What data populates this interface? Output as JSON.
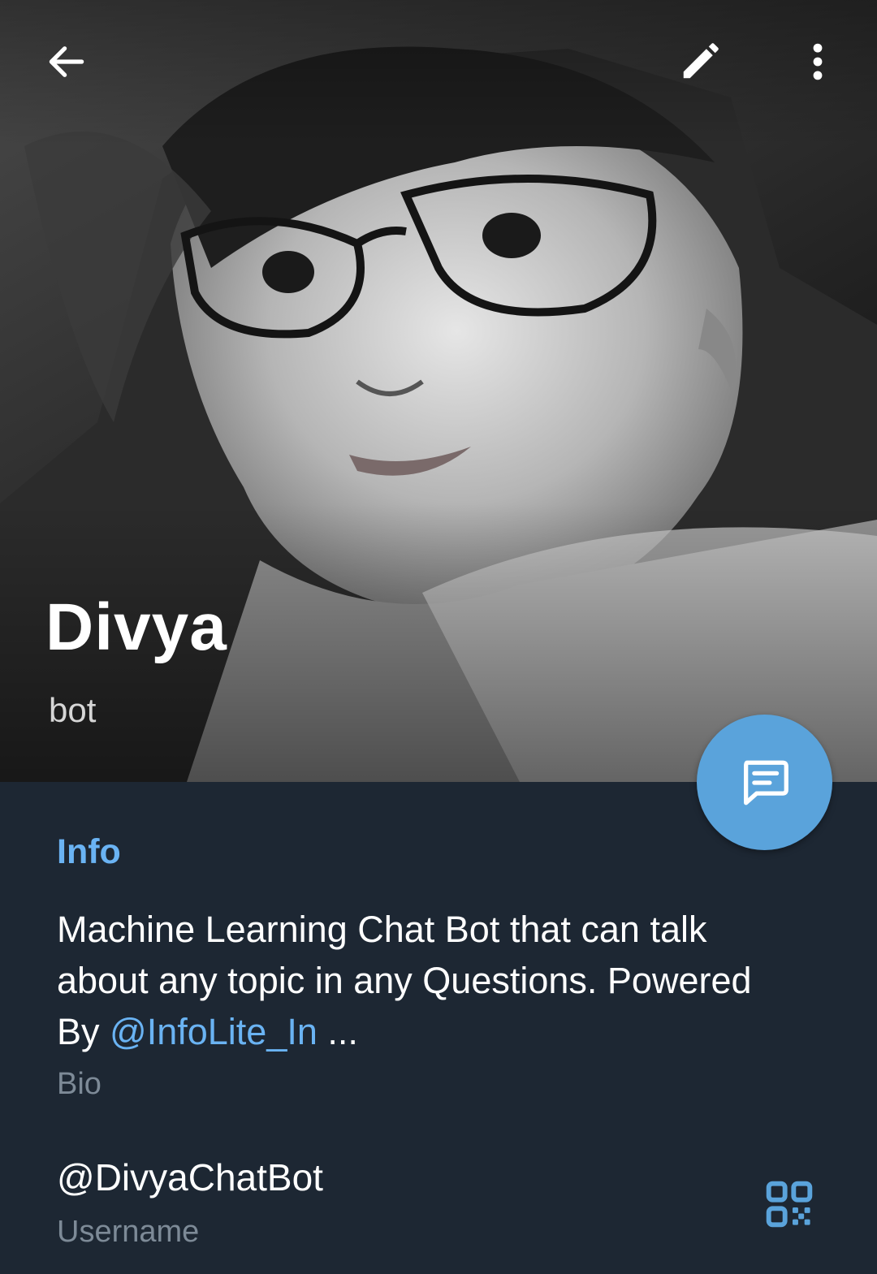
{
  "profile": {
    "name": "Divya",
    "status": "bot"
  },
  "toolbar": {
    "back_icon": "arrow-left-icon",
    "edit_icon": "pencil-icon",
    "more_icon": "more-vertical-icon"
  },
  "fab": {
    "icon": "message-icon"
  },
  "info": {
    "title": "Info",
    "bio_text": "Machine Learning Chat Bot that can talk about any topic in any Questions. Powered By ",
    "bio_link": "@InfoLite_In",
    "bio_ellipsis": " ...",
    "bio_label": "Bio",
    "username": "@DivyaChatBot",
    "username_label": "Username",
    "qr_icon": "qr-code-icon"
  },
  "colors": {
    "accent": "#6ab3f3",
    "fab": "#5aa3db",
    "background": "#1d2733",
    "secondary_text": "#7d8a97"
  }
}
